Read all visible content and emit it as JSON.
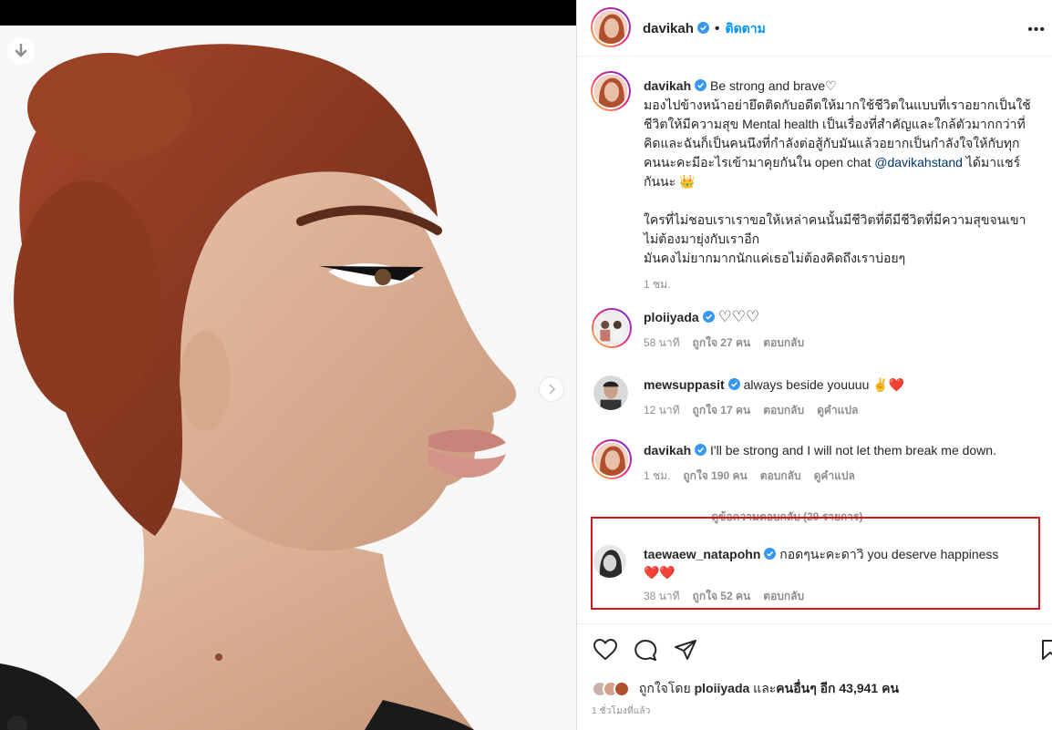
{
  "post": {
    "author": "davikah",
    "follow_label": "ติดตาม",
    "dot": "•",
    "more": "•••"
  },
  "caption": {
    "username": "davikah",
    "first": "Be strong and brave♡",
    "line1": "มองไปข้างหน้าอย่ายึดติดกับอดีตให้มากใช้ชีวิตในแบบที่เราอยากเป็นใช้",
    "line2": "ชีวิตให้มีความสุข Mental health เป็นเรื่องที่สำคัญและใกล้ตัวมากกว่าที่",
    "line3": "คิดและฉันก็เป็นคนนึงที่กำลังต่อสู้กับมันแล้วอยากเป็นกำลังใจให้กับทุก",
    "line4_pre": "คนนะคะมีอะไรเข้ามาคุยกันใน open chat ",
    "mention": "@davikahstand",
    "line4_post": " ได้มาแชร์",
    "line5": "กันนะ 👑",
    "line6": "ใครที่ไม่ชอบเราเราขอให้เหล่าคนนั้นมีชีวิตที่ดีมีชีวิตที่มีความสุขจนเขา",
    "line7": "ไม่ต้องมายุ่งกับเราอีก",
    "line8": "มันคงไม่ยากมากนักแค่เธอไม่ต้องคิดถึงเราบ่อยๆ",
    "time": "1 ชม."
  },
  "comments": [
    {
      "username": "ploiiyada",
      "text": "♡♡♡",
      "time": "58 นาที",
      "likes": "ถูกใจ 27 คน",
      "reply": "ตอบกลับ",
      "translate": ""
    },
    {
      "username": "mewsuppasit",
      "text": "always beside youuuu ✌️❤️",
      "time": "12 นาที",
      "likes": "ถูกใจ 17 คน",
      "reply": "ตอบกลับ",
      "translate": "ดูคำแปล"
    },
    {
      "username": "davikah",
      "text": "I'll be strong and I will not let them break me down.",
      "time": "1 ชม.",
      "likes": "ถูกใจ 190 คน",
      "reply": "ตอบกลับ",
      "translate": "ดูคำแปล"
    },
    {
      "username": "taewaew_natapohn",
      "text": "กอดๆนะคะดาวิ you deserve happiness",
      "text2": "❤️❤️",
      "time": "38 นาที",
      "likes": "ถูกใจ 52 คน",
      "reply": "ตอบกลับ",
      "translate": ""
    }
  ],
  "view_replies": "—— ดูข้อความตอบกลับ (29 รายการ)",
  "likes_summary": {
    "pre": "ถูกใจโดย ",
    "user": "ploiiyada",
    "mid": " และ",
    "others": "คนอื่นๆ อีก 43,941 คน"
  },
  "posted_ago": "1 ชั่วโมงที่แล้ว",
  "colors": {
    "link": "#0095f6",
    "mention": "#00376b",
    "muted": "#8e8e8e",
    "highlight": "#d8141b",
    "verified": "#3897f0"
  }
}
